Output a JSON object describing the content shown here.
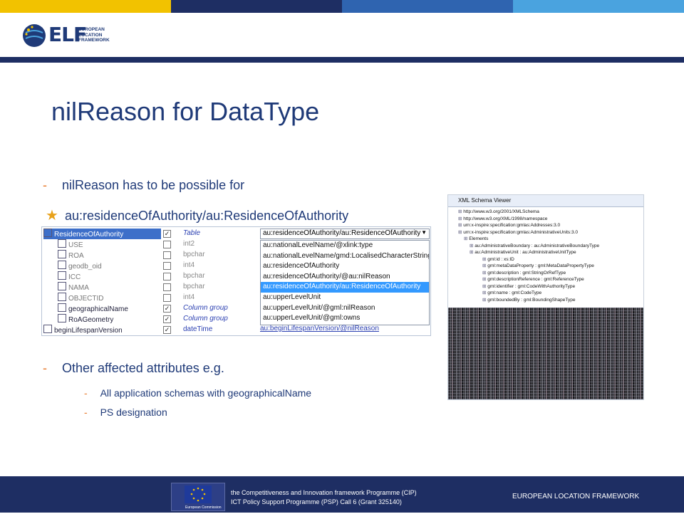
{
  "header": {
    "logo_text": "ELF",
    "logo_caption_1": "EUROPEAN",
    "logo_caption_2": "LOCATION",
    "logo_caption_3": "FRAMEWORK"
  },
  "title": "nilReason for DataType",
  "bullets": {
    "b1": "nilReason has to be possible for",
    "b2": "au:residenceOfAuthority/au:ResidenceOfAuthority",
    "b3": "Other affected attributes e.g.",
    "b3a": "All application schemas with geographicalName",
    "b3b": "PS designation"
  },
  "tree_rows": [
    "ResidenceOfAuthority",
    "USE",
    "ROA",
    "geodb_oid",
    "ICC",
    "NAMA",
    "OBJECTID",
    "geographicalName",
    "RoAGeometry",
    "beginLifespanVersion"
  ],
  "types": [
    "Table",
    "int2",
    "bpchar",
    "int4",
    "bpchar",
    "bpchar",
    "int4",
    "Column group",
    "Column group",
    "dateTime"
  ],
  "dropdown_value": "au:residenceOfAuthority/au:ResidenceOfAuthority",
  "dropdown_options": [
    "au:nationalLevelName/@xlink:type",
    "au:nationalLevelName/gmd:LocalisedCharacterString",
    "au:residenceOfAuthority",
    "au:residenceOfAuthority/@au:nilReason",
    "au:residenceOfAuthority/au:ResidenceOfAuthority",
    "au:upperLevelUnit",
    "au:upperLevelUnit/@gml:nilReason",
    "au:upperLevelUnit/@gml:owns"
  ],
  "last_mapping": "au:beginLifespanVersion/@nilReason",
  "schema_viewer": {
    "title": "XML Schema Viewer",
    "lines": [
      "http://www.w3.org/2001/XMLSchema",
      "http://www.w3.org/XML/1998/namespace",
      "urn:x-inspire:specification:gmlas:Addresses:3.0",
      "urn:x-inspire:specification:gmlas:AdministrativeUnits:3.0",
      "Elements",
      "au:AdministrativeBoundary : au:AdministrativeBoundaryType",
      "au:AdministrativeUnit : au:AdministrativeUnitType",
      "gml:id : xs:ID",
      "gml:metaDataProperty : gml:MetaDataPropertyType",
      "gml:description : gml:StringOrRefType",
      "gml:descriptionReference : gml:ReferenceType",
      "gml:identifier : gml:CodeWithAuthorityType",
      "gml:name : gml:CodeType",
      "gml:boundedBy : gml:BoundingShapeType"
    ]
  },
  "footer": {
    "line1": "the Competitiveness and Innovation framework Programme (CIP)",
    "line2": "ICT Policy Support Programme (PSP) Call 6 (Grant 325140)",
    "right": "EUROPEAN LOCATION FRAMEWORK",
    "ec_label": "European Commission"
  },
  "colors": {
    "bar1": "#f2c200",
    "bar2": "#1e2e63",
    "bar3": "#2f64b0",
    "bar4": "#4aa3df",
    "accent": "#e87a2c"
  }
}
